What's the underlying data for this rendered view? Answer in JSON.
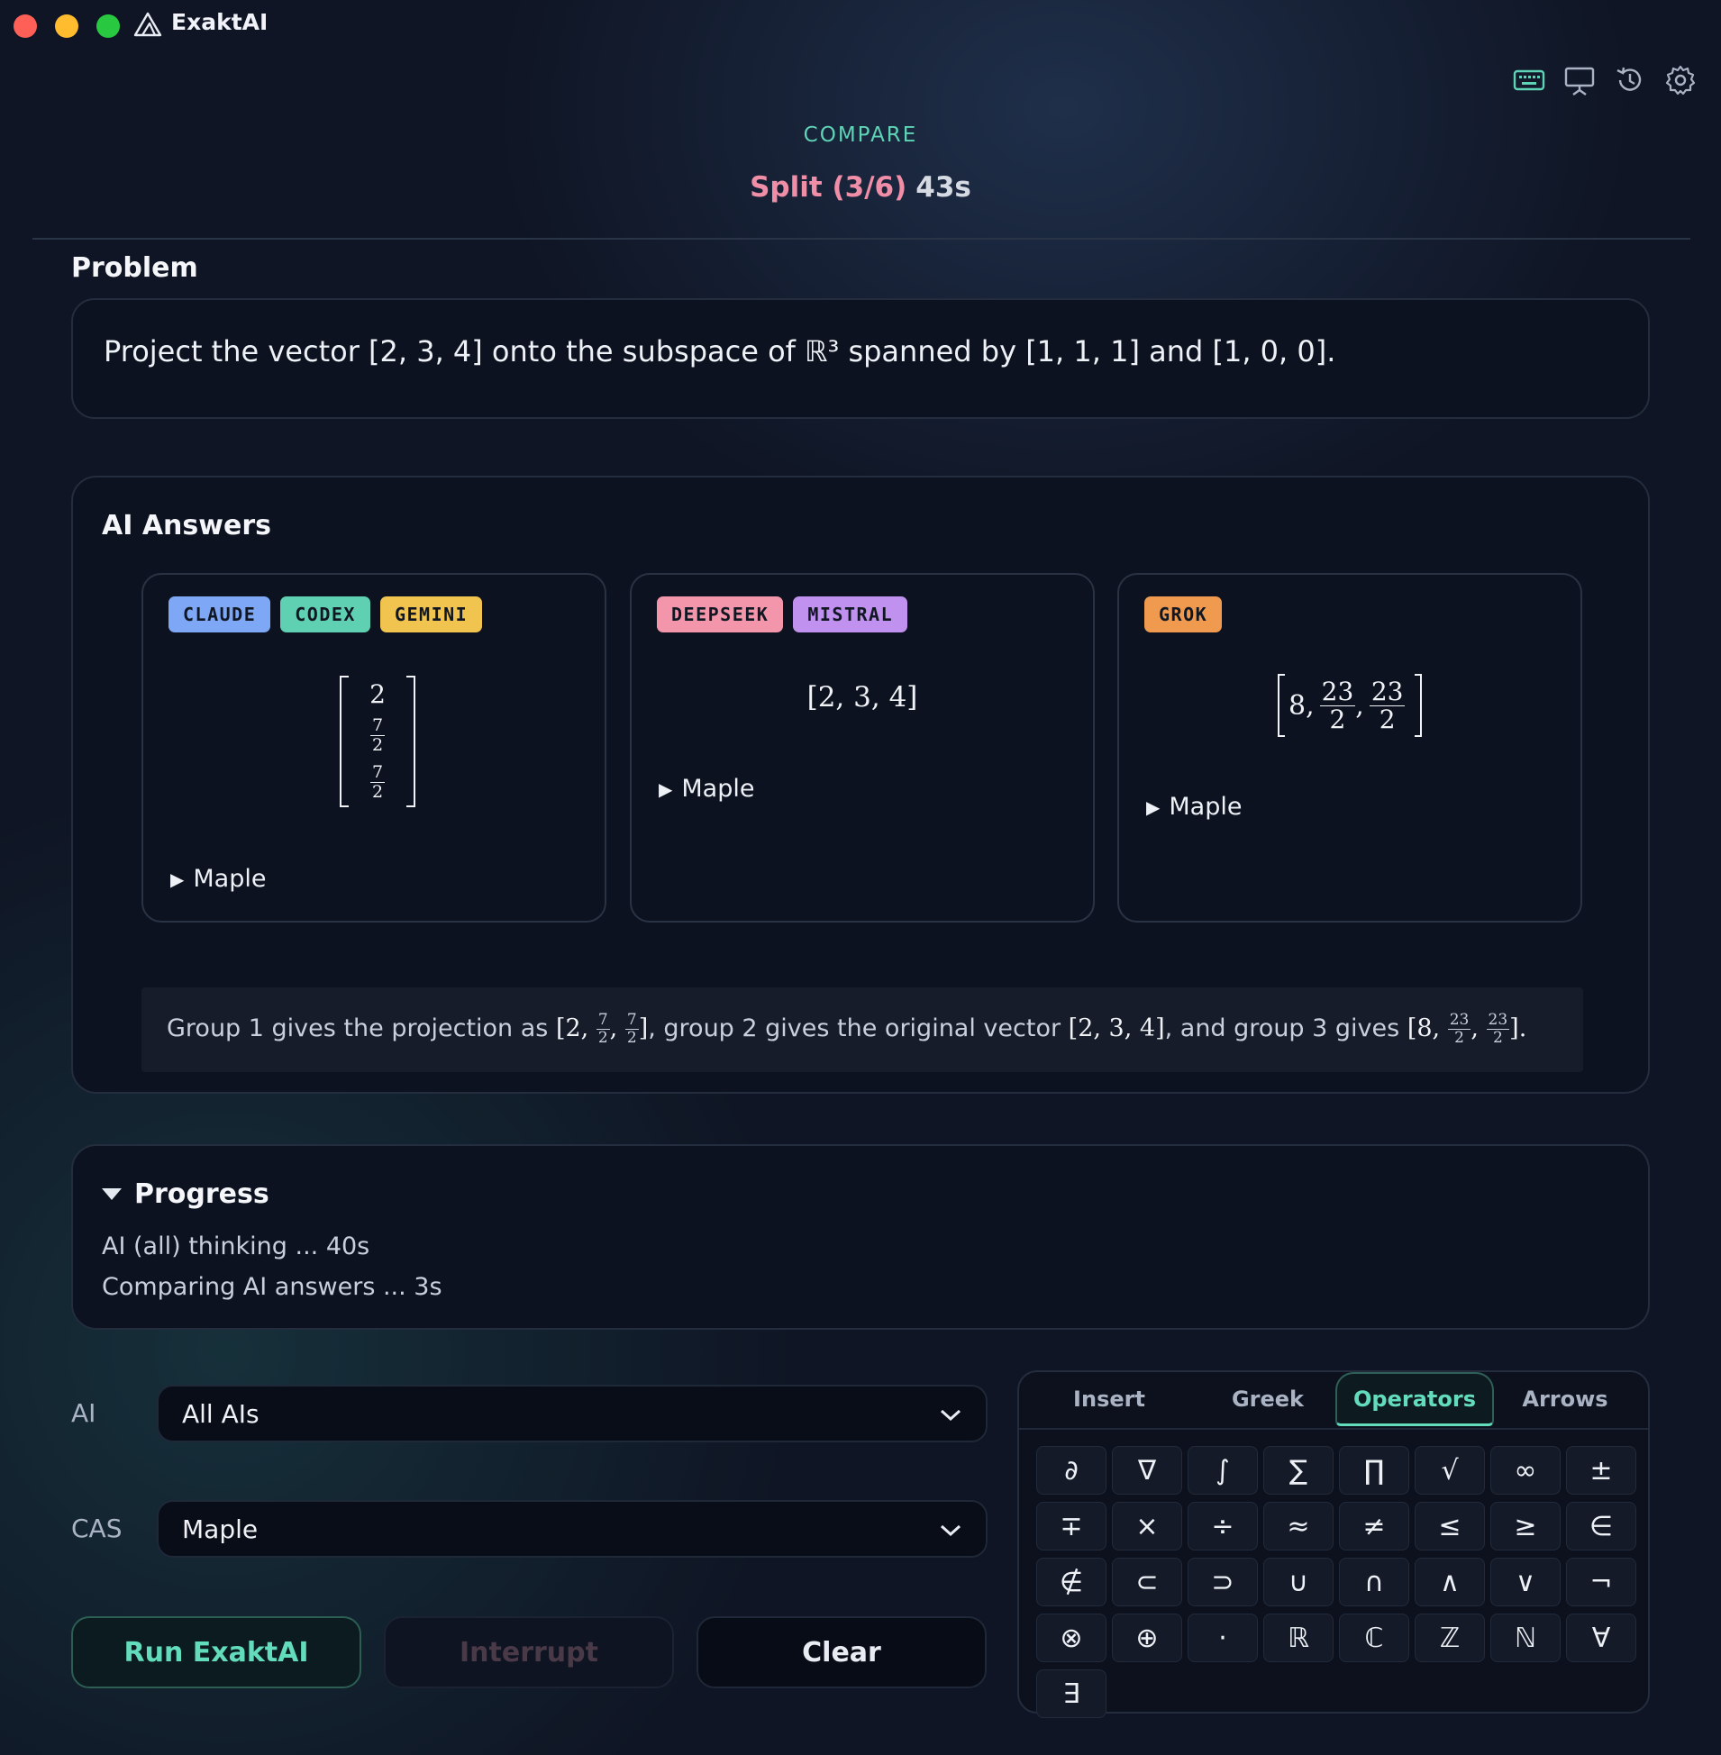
{
  "app": {
    "name": "ExaktAI"
  },
  "header": {
    "mode": "COMPARE",
    "status_split": "Split (3/6)",
    "status_time": "43s",
    "icons": [
      "keyboard-icon",
      "presentation-icon",
      "history-icon",
      "settings-gear-icon"
    ]
  },
  "problem": {
    "title": "Problem",
    "text": "Project the vector [2, 3, 4] onto the subspace of ℝ³ spanned by [1, 1, 1] and [1, 0, 0]."
  },
  "answers": {
    "title": "AI Answers",
    "cards": [
      {
        "badges": [
          "CLAUDE",
          "CODEX",
          "GEMINI"
        ],
        "entries": [
          {
            "num": "2",
            "den": ""
          },
          {
            "num": "7",
            "den": "2"
          },
          {
            "num": "7",
            "den": "2"
          }
        ],
        "maple_label": "Maple"
      },
      {
        "badges": [
          "DEEPSEEK",
          "MISTRAL"
        ],
        "expr": "[2, 3, 4]",
        "maple_label": "Maple"
      },
      {
        "badges": [
          "GROK"
        ],
        "entries": [
          {
            "num": "8",
            "den": ""
          },
          {
            "num": "23",
            "den": "2"
          },
          {
            "num": "23",
            "den": "2"
          }
        ],
        "maple_label": "Maple"
      }
    ],
    "summary": {
      "part1": "Group 1 gives the projection as",
      "v1_open": "[2,",
      "v1_f1_num": "7",
      "v1_f1_den": "2",
      "v1_f2_num": "7",
      "v1_f2_den": "2",
      "part2": ", group 2 gives the original vector",
      "v2": "[2, 3, 4]",
      "part3": ", and group 3 gives",
      "v3_open": "[8,",
      "v3_f1_num": "23",
      "v3_f1_den": "2",
      "v3_f2_num": "23",
      "v3_f2_den": "2",
      "end": "]."
    }
  },
  "progress": {
    "title": "Progress",
    "lines": [
      "AI (all) thinking ... 40s",
      "Comparing AI answers ... 3s"
    ]
  },
  "controls": {
    "ai_label": "AI",
    "ai_value": "All AIs",
    "cas_label": "CAS",
    "cas_value": "Maple",
    "run_label": "Run ExaktAI",
    "interrupt_label": "Interrupt",
    "clear_label": "Clear"
  },
  "keypad": {
    "tabs": [
      "Insert",
      "Greek",
      "Operators",
      "Arrows"
    ],
    "active_tab": "Operators",
    "keys": [
      "∂",
      "∇",
      "∫",
      "∑",
      "∏",
      "√",
      "∞",
      "±",
      "∓",
      "×",
      "÷",
      "≈",
      "≠",
      "≤",
      "≥",
      "∈",
      "∉",
      "⊂",
      "⊃",
      "∪",
      "∩",
      "∧",
      "∨",
      "¬",
      "⊗",
      "⊕",
      "·",
      "ℝ",
      "ℂ",
      "ℤ",
      "ℕ",
      "∀",
      "∃"
    ]
  },
  "colors": {
    "accent": "#62dcbb",
    "status_split": "#f08ea8",
    "badge_claude": "#7ea7f5",
    "badge_codex": "#5fd1b2",
    "badge_gemini": "#f1c34f",
    "badge_deepseek": "#f396ab",
    "badge_mistral": "#c191f0",
    "badge_grok": "#ef9a4f"
  }
}
